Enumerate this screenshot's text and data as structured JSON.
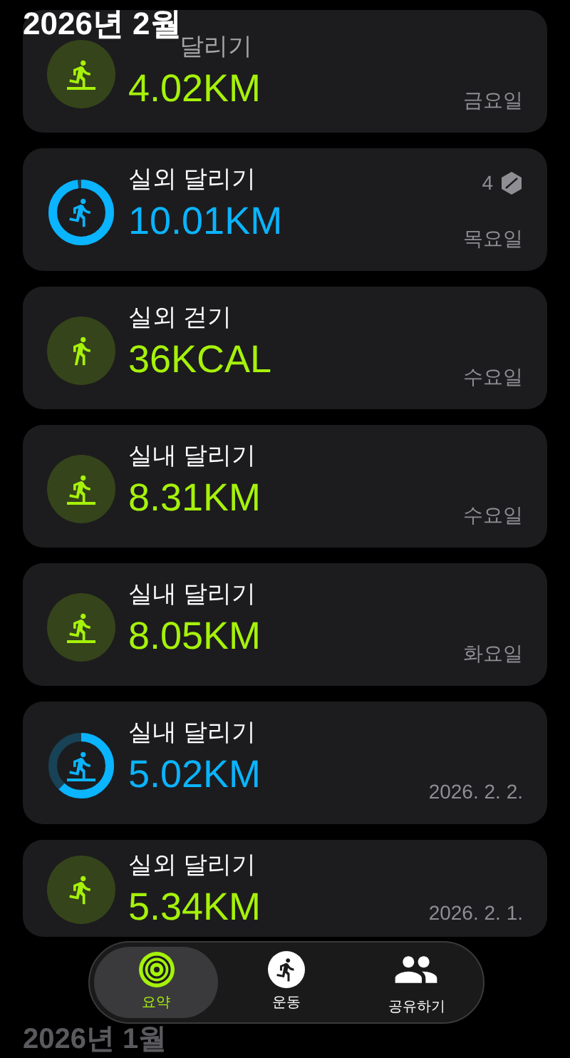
{
  "header": {
    "title": "2026년 2월"
  },
  "workouts": [
    {
      "title": "달리기",
      "value": "4.02KM",
      "day": "금요일",
      "kind": "treadmill",
      "color": "#a6f20a",
      "ring": false
    },
    {
      "title": "실외 달리기",
      "value": "10.01KM",
      "day": "목요일",
      "kind": "run",
      "color": "#0ab4ff",
      "ring": true,
      "badge": "4"
    },
    {
      "title": "실외 걷기",
      "value": "36KCAL",
      "day": "수요일",
      "kind": "walk",
      "color": "#a6f20a",
      "ring": false
    },
    {
      "title": "실내 달리기",
      "value": "8.31KM",
      "day": "수요일",
      "kind": "treadmill",
      "color": "#a6f20a",
      "ring": false
    },
    {
      "title": "실내 달리기",
      "value": "8.05KM",
      "day": "화요일",
      "kind": "treadmill",
      "color": "#a6f20a",
      "ring": false
    },
    {
      "title": "실내 달리기",
      "value": "5.02KM",
      "day": "2026. 2. 2.",
      "kind": "treadmill",
      "color": "#0ab4ff",
      "ring": true
    },
    {
      "title": "실외 달리기",
      "value": "5.34KM",
      "day": "2026. 2. 1.",
      "kind": "run",
      "color": "#a6f20a",
      "ring": false
    }
  ],
  "next_section": {
    "title": "2026년 1월"
  },
  "tab_bar": [
    {
      "label": "요약",
      "selected": true
    },
    {
      "label": "운동",
      "selected": false
    },
    {
      "label": "공유하기",
      "selected": false
    }
  ]
}
